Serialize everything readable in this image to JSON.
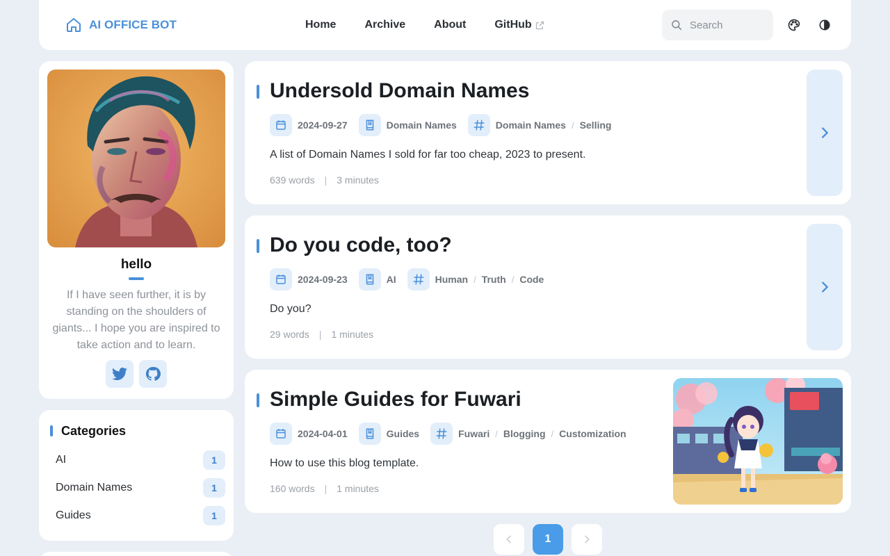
{
  "nav": {
    "brand": "AI OFFICE BOT",
    "links": [
      "Home",
      "Archive",
      "About",
      "GitHub"
    ],
    "search_placeholder": "Search"
  },
  "profile": {
    "name": "hello",
    "bio": "If I have seen further, it is by standing on the shoulders of giants... I hope you are inspired to take action and to learn.",
    "social": [
      "twitter-icon",
      "github-icon"
    ]
  },
  "categories": {
    "title": "Categories",
    "items": [
      {
        "name": "AI",
        "count": "1"
      },
      {
        "name": "Domain Names",
        "count": "1"
      },
      {
        "name": "Guides",
        "count": "1"
      }
    ]
  },
  "posts": [
    {
      "title": "Undersold Domain Names",
      "date": "2024-09-27",
      "category": "Domain Names",
      "tags": [
        "Domain Names",
        "Selling"
      ],
      "excerpt": "A list of Domain Names I sold for far too cheap, 2023 to present.",
      "words": "639 words",
      "minutes": "3 minutes",
      "separator": "|"
    },
    {
      "title": "Do you code, too?",
      "date": "2024-09-23",
      "category": "AI",
      "tags": [
        "Human",
        "Truth",
        "Code"
      ],
      "excerpt": "Do you?",
      "words": "29 words",
      "minutes": "1 minutes",
      "separator": "|"
    },
    {
      "title": "Simple Guides for Fuwari",
      "date": "2024-04-01",
      "category": "Guides",
      "tags": [
        "Fuwari",
        "Blogging",
        "Customization"
      ],
      "excerpt": "How to use this blog template.",
      "words": "160 words",
      "minutes": "1 minutes",
      "separator": "|"
    }
  ],
  "tag_separator": "/",
  "pagination": {
    "current": "1"
  },
  "colors": {
    "accent": "#4a90d9",
    "accent_soft": "#e3eefb",
    "background": "#eaeff5"
  }
}
